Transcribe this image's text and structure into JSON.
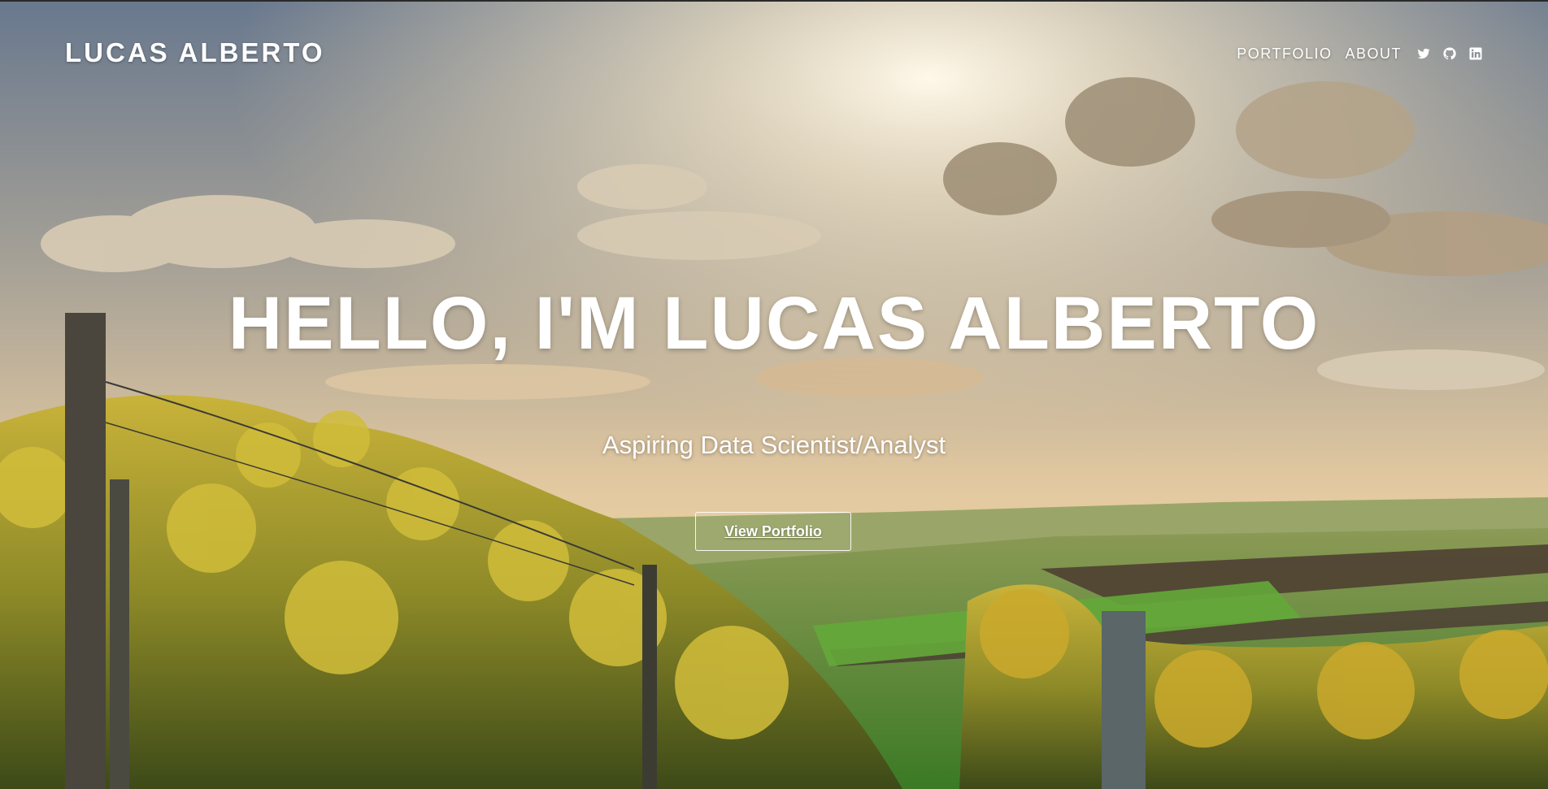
{
  "header": {
    "brand": "LUCAS ALBERTO",
    "nav": {
      "portfolio": "PORTFOLIO",
      "about": "ABOUT"
    },
    "social_icons": [
      "twitter-icon",
      "github-icon",
      "linkedin-icon"
    ]
  },
  "hero": {
    "headline": "HELLO, I'M LUCAS ALBERTO",
    "subheadline": "Aspiring Data Scientist/Analyst",
    "cta_label": "View Portfolio",
    "background_image": "vineyard-sunset-photo"
  },
  "colors": {
    "text": "#ffffff",
    "sky_top": "#6f7f93",
    "sun_glow": "#fbeed4",
    "field_green": "#4f8a2c",
    "vine_yellow": "#b5a12e"
  }
}
